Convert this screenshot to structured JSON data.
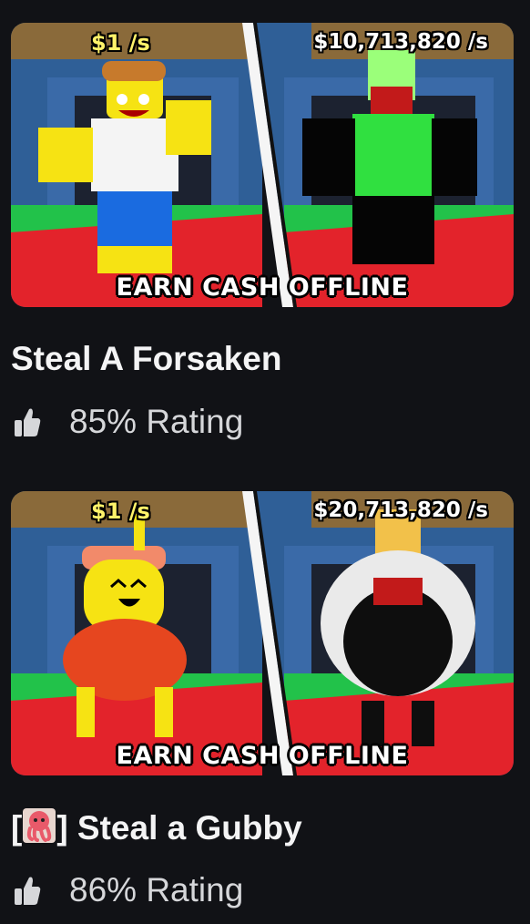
{
  "games": [
    {
      "title": "Steal A Forsaken",
      "rating_text": "85% Rating",
      "rating_icon": "thumbs-up-icon",
      "thumbnail": {
        "left_rate": "$1 /s",
        "right_rate": "$10,713,820 /s",
        "banner": "EARN CASH OFFLINE"
      }
    },
    {
      "title_prefix": "[",
      "title_emoji": "octopus-icon",
      "title_suffix": "] Steal a Gubby",
      "rating_text": "86% Rating",
      "rating_icon": "thumbs-up-icon",
      "thumbnail": {
        "left_rate": "$1 /s",
        "right_rate": "$20,713,820 /s",
        "banner": "EARN CASH OFFLINE"
      }
    }
  ],
  "colors": {
    "background": "#111216",
    "text_primary": "#f4f4f5",
    "text_secondary": "#d6d7da"
  }
}
